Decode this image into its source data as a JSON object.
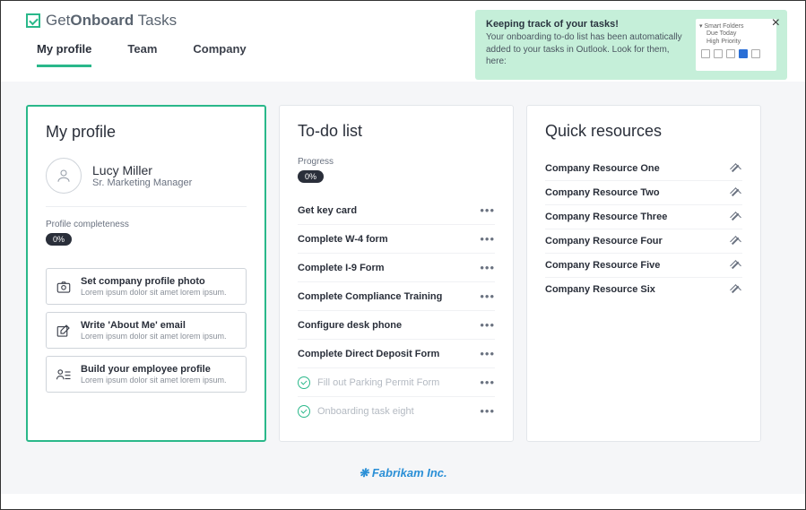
{
  "app_name": {
    "light1": "Get",
    "bold": "Onboard",
    "light2": " Tasks"
  },
  "tabs": [
    {
      "label": "My profile",
      "active": true
    },
    {
      "label": "Team",
      "active": false
    },
    {
      "label": "Company",
      "active": false
    }
  ],
  "banner": {
    "title": "Keeping track of your tasks!",
    "body": "Your onboarding to-do list has been automatically added to your tasks in Outlook. Look for them, here:",
    "folder_label": "Smart Folders",
    "folder_items": [
      "Due Today",
      "High Priority"
    ]
  },
  "profile": {
    "title": "My profile",
    "name": "Lucy Miller",
    "role": "Sr. Marketing Manager",
    "completeness_label": "Profile completeness",
    "completeness_value": "0%",
    "actions": [
      {
        "icon": "camera",
        "title": "Set company profile photo",
        "sub": "Lorem ipsum dolor sit amet lorem ipsum."
      },
      {
        "icon": "compose",
        "title": "Write 'About Me' email",
        "sub": "Lorem ipsum dolor sit amet lorem ipsum."
      },
      {
        "icon": "people",
        "title": "Build your employee profile",
        "sub": "Lorem ipsum dolor sit amet lorem ipsum."
      }
    ]
  },
  "todo": {
    "title": "To-do list",
    "progress_label": "Progress",
    "progress_value": "0%",
    "tasks": [
      {
        "title": "Get key card",
        "done": false
      },
      {
        "title": "Complete W-4 form",
        "done": false
      },
      {
        "title": "Complete I-9 Form",
        "done": false
      },
      {
        "title": "Complete Compliance Training",
        "done": false
      },
      {
        "title": "Configure desk phone",
        "done": false
      },
      {
        "title": "Complete Direct Deposit Form",
        "done": false
      },
      {
        "title": "Fill out Parking Permit Form",
        "done": true
      },
      {
        "title": "Onboarding task eight",
        "done": true
      }
    ]
  },
  "resources": {
    "title": "Quick resources",
    "items": [
      "Company Resource One",
      "Company Resource Two",
      "Company Resource Three",
      "Company Resource Four",
      "Company Resource Five",
      "Company Resource Six"
    ]
  },
  "footer": "Fabrikam Inc."
}
